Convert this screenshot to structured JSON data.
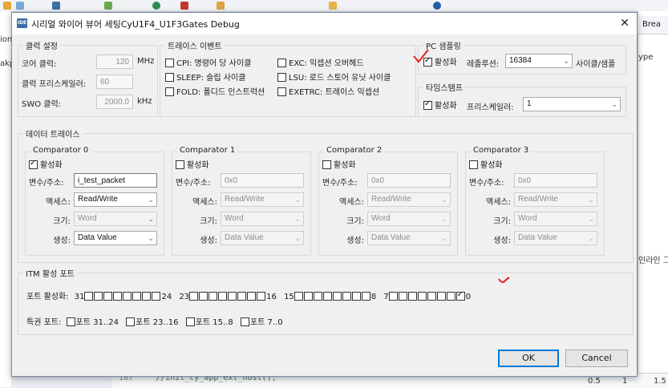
{
  "background": {
    "right_tab_label": "Brea",
    "right_text_1": "ype",
    "right_text_2": "인라인 그",
    "left_text_1": "ion",
    "left_text_2": "akp",
    "code_line_number": "187",
    "code_line_text": "//init_cy_app_ext_host();",
    "ruler": [
      "0.5",
      "1",
      "1.5"
    ]
  },
  "dialog": {
    "icon_text": "IDE",
    "title": "시리얼 와이어 뷰어 세팅CyU1F4_U1F3Gates Debug",
    "close_symbol": "✕",
    "clock": {
      "title": "클럭 설정",
      "core_label": "코어 클럭:",
      "core_value": "120",
      "core_unit": "MHz",
      "prescaler_label": "클럭 프리스케일러:",
      "prescaler_value": "60",
      "swo_label": "SWO 클럭:",
      "swo_value": "2000.0",
      "swo_unit": "kHz"
    },
    "trace_events": {
      "title": "트레이스 이벤트",
      "items": [
        {
          "label": "CPI: 명령어 당 사이클",
          "checked": false
        },
        {
          "label": "EXC: 익셉션 오버헤드",
          "checked": false
        },
        {
          "label": "SLEEP: 슬립 사이클",
          "checked": false
        },
        {
          "label": "LSU: 로드 스토어 유닛 사이클",
          "checked": false
        },
        {
          "label": "FOLD: 폴디드 인스트럭션",
          "checked": false
        },
        {
          "label": "EXETRC: 트레이스 익셉션",
          "checked": false
        }
      ]
    },
    "pc_sampling": {
      "title": "PC 샘플링",
      "enable_label": "활성화",
      "enabled": true,
      "resolution_label": "레졸루션:",
      "resolution_value": "16384",
      "unit": "사이클/샘플"
    },
    "timestamp": {
      "title": "타임스탬프",
      "enable_label": "활성화",
      "enabled": true,
      "prescaler_label": "프리스케일러:",
      "prescaler_value": "1"
    },
    "data_trace": {
      "title": "데이터 트레이스",
      "var_label": "변수/주소:",
      "access_label": "액세스:",
      "size_label": "크기:",
      "gen_label": "생성:",
      "enable_label": "활성화",
      "comparators": [
        {
          "name": "Comparator 0",
          "enabled": true,
          "address": "i_test_packet",
          "access": "Read/Write",
          "size": "Word",
          "generate": "Data Value"
        },
        {
          "name": "Comparator 1",
          "enabled": false,
          "address": "0x0",
          "access": "Read/Write",
          "size": "Word",
          "generate": "Data Value"
        },
        {
          "name": "Comparator 2",
          "enabled": false,
          "address": "0x0",
          "access": "Read/Write",
          "size": "Word",
          "generate": "Data Value"
        },
        {
          "name": "Comparator 3",
          "enabled": false,
          "address": "0x0",
          "access": "Read/Write",
          "size": "Word",
          "generate": "Data Value"
        }
      ]
    },
    "itm": {
      "title": "ITM 활성 포트",
      "port_enable_label": "포트 활성화:",
      "groups": [
        {
          "start": "31",
          "end": "24"
        },
        {
          "start": "23",
          "end": "16"
        },
        {
          "start": "15",
          "end": "8"
        },
        {
          "start": "7",
          "end": "0"
        }
      ],
      "enabled_port": 0,
      "privileged_label": "특권 포트:",
      "privileged": [
        {
          "label": "포트 31..24",
          "checked": false
        },
        {
          "label": "포트 23..16",
          "checked": false
        },
        {
          "label": "포트 15..8",
          "checked": false
        },
        {
          "label": "포트 7..0",
          "checked": false
        }
      ]
    },
    "ok_label": "OK",
    "cancel_label": "Cancel"
  }
}
